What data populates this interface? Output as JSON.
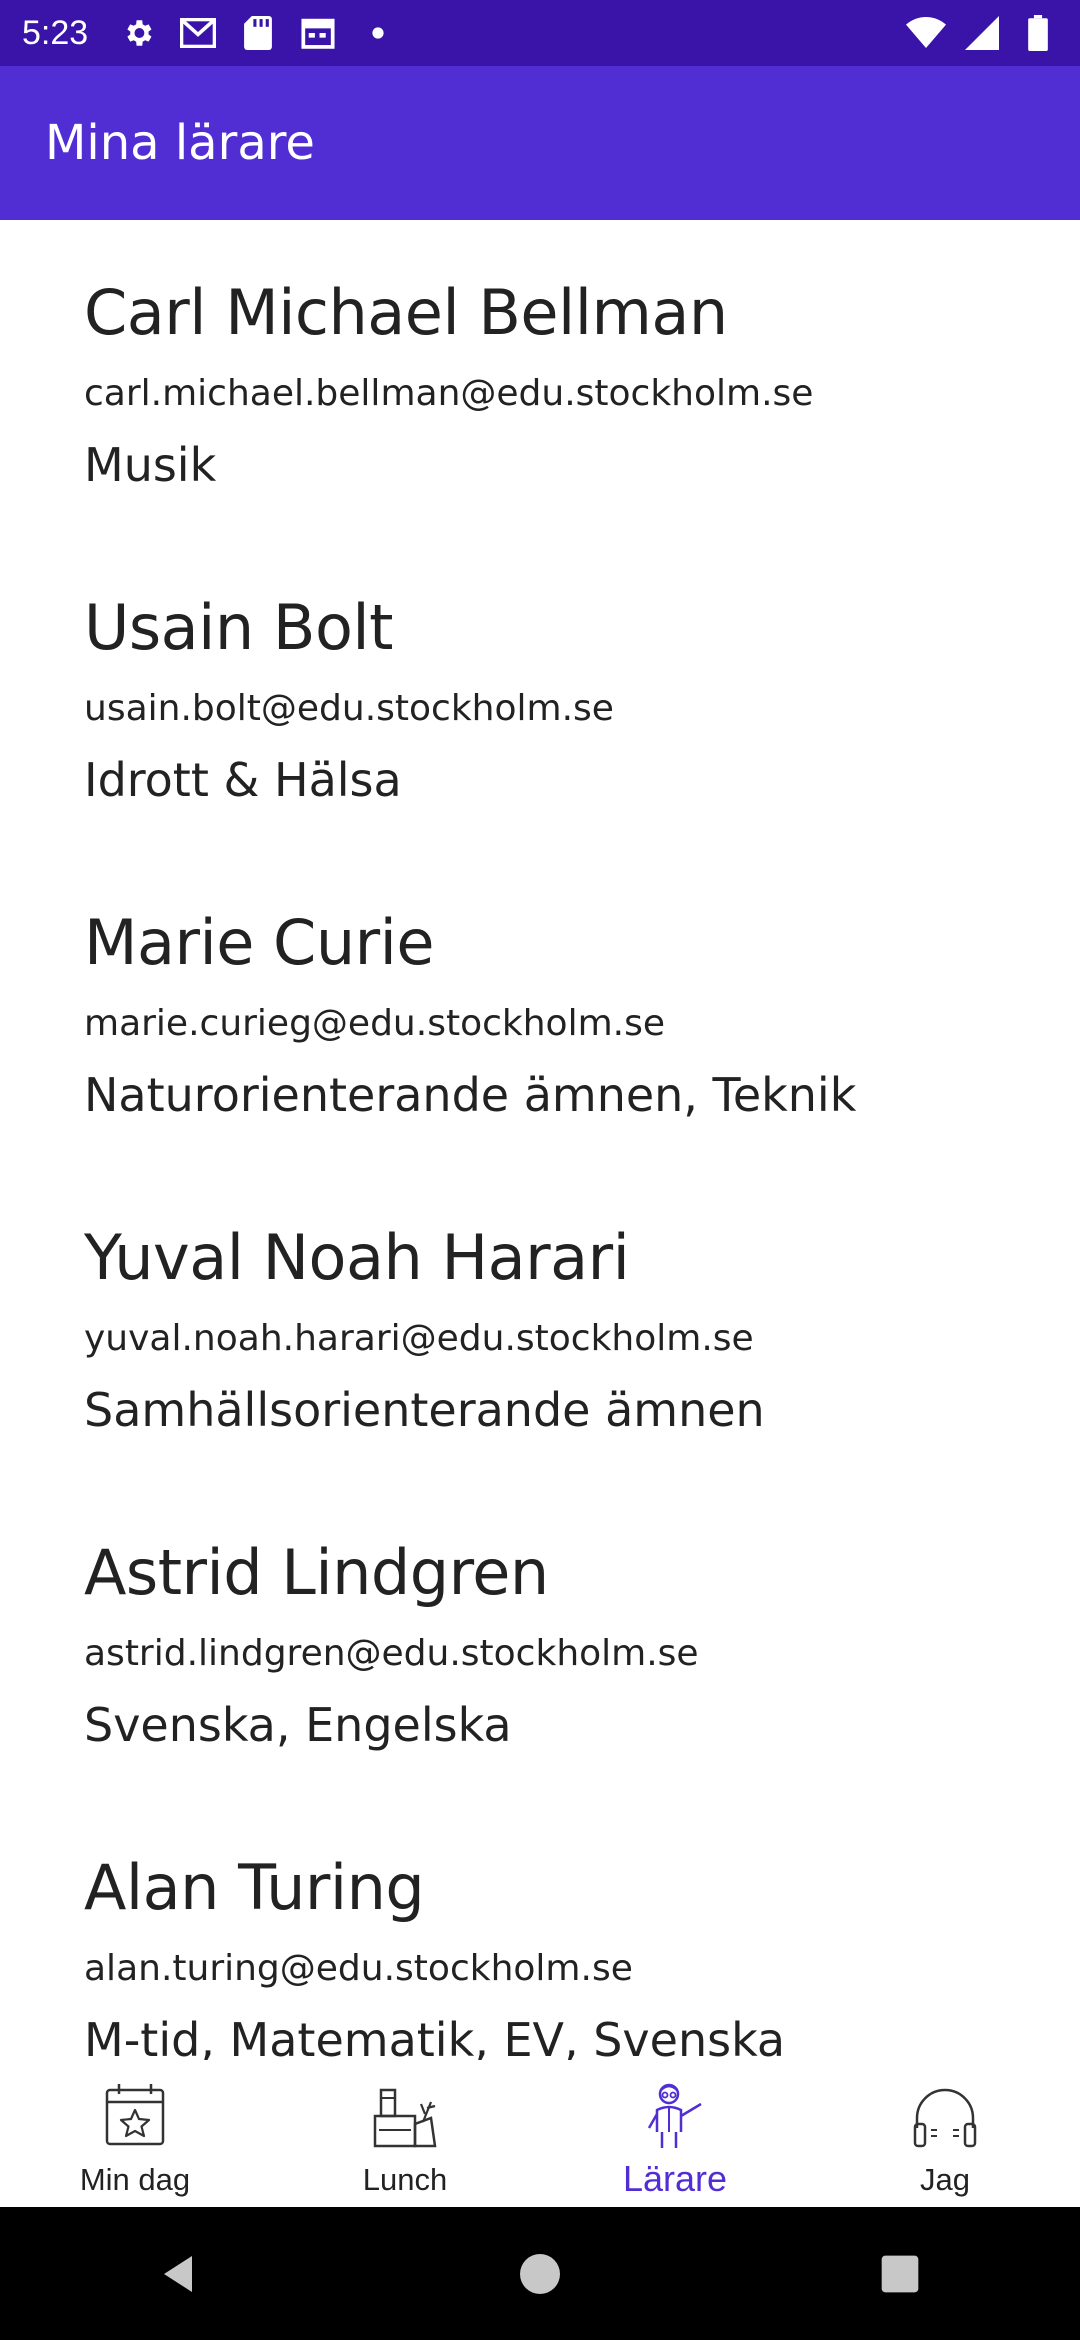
{
  "status_bar": {
    "time": "5:23",
    "left_icons": [
      "gear-icon",
      "gmail-icon",
      "sd-card-icon",
      "calendar-icon",
      "dot-icon"
    ],
    "right_icons": [
      "wifi-icon",
      "signal-icon",
      "battery-icon"
    ]
  },
  "app_bar": {
    "title": "Mina lärare"
  },
  "teachers": [
    {
      "name": "Carl Michael Bellman",
      "email": "carl.michael.bellman@edu.stockholm.se",
      "subject": "Musik"
    },
    {
      "name": "Usain Bolt",
      "email": "usain.bolt@edu.stockholm.se",
      "subject": "Idrott & Hälsa"
    },
    {
      "name": "Marie Curie",
      "email": "marie.curieg@edu.stockholm.se",
      "subject": "Naturorienterande ämnen, Teknik"
    },
    {
      "name": "Yuval Noah Harari",
      "email": "yuval.noah.harari@edu.stockholm.se",
      "subject": "Samhällsorienterande ämnen"
    },
    {
      "name": "Astrid Lindgren",
      "email": "astrid.lindgren@edu.stockholm.se",
      "subject": "Svenska, Engelska"
    },
    {
      "name": "Alan Turing",
      "email": "alan.turing@edu.stockholm.se",
      "subject": "M-tid, Matematik, EV, Svenska"
    }
  ],
  "bottom_nav": {
    "items": [
      {
        "label": "Min dag",
        "icon": "calendar-star-icon",
        "active": false
      },
      {
        "label": "Lunch",
        "icon": "lunch-icon",
        "active": false
      },
      {
        "label": "Lärare",
        "icon": "teacher-icon",
        "active": true
      },
      {
        "label": "Jag",
        "icon": "headphones-icon",
        "active": false
      }
    ]
  },
  "system_nav": {
    "buttons": [
      "back-icon",
      "home-icon",
      "recents-icon"
    ]
  },
  "colors": {
    "status_bar": "#3a14a8",
    "app_bar": "#512ed4",
    "accent": "#512ed4",
    "text": "#222222"
  }
}
